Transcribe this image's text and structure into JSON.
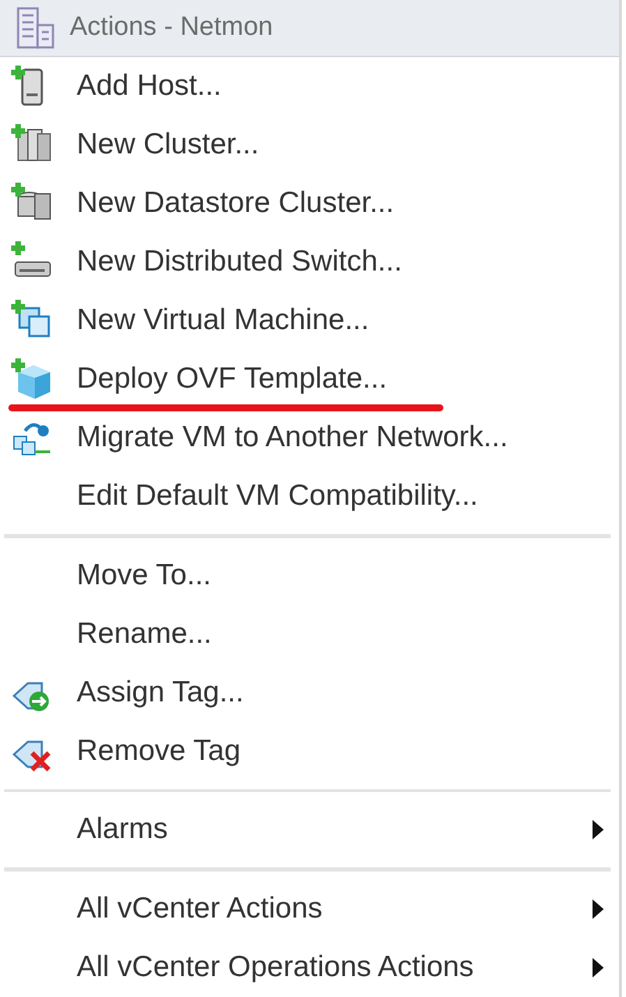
{
  "header": {
    "title": "Actions - Netmon"
  },
  "groups": [
    {
      "items": [
        {
          "label": "Add Host...",
          "kind": "host",
          "submenu": false,
          "underlined": false
        },
        {
          "label": "New Cluster...",
          "kind": "cluster",
          "submenu": false,
          "underlined": false
        },
        {
          "label": "New Datastore Cluster...",
          "kind": "datastore",
          "submenu": false,
          "underlined": false
        },
        {
          "label": "New Distributed Switch...",
          "kind": "switch",
          "submenu": false,
          "underlined": false
        },
        {
          "label": "New Virtual Machine...",
          "kind": "vm",
          "submenu": false,
          "underlined": false
        },
        {
          "label": "Deploy OVF Template...",
          "kind": "ovf",
          "submenu": false,
          "underlined": true
        },
        {
          "label": "Migrate VM to Another Network...",
          "kind": "migrate",
          "submenu": false,
          "underlined": false
        },
        {
          "label": "Edit Default VM Compatibility...",
          "kind": "plain",
          "submenu": false,
          "underlined": false
        }
      ]
    },
    {
      "items": [
        {
          "label": "Move To...",
          "kind": "plain",
          "submenu": false,
          "underlined": false
        },
        {
          "label": "Rename...",
          "kind": "plain",
          "submenu": false,
          "underlined": false
        },
        {
          "label": "Assign Tag...",
          "kind": "assign",
          "submenu": false,
          "underlined": false
        },
        {
          "label": "Remove Tag",
          "kind": "remove",
          "submenu": false,
          "underlined": false
        }
      ]
    },
    {
      "items": [
        {
          "label": "Alarms",
          "kind": "plain",
          "submenu": true,
          "underlined": false
        }
      ]
    },
    {
      "items": [
        {
          "label": "All vCenter Actions",
          "kind": "plain",
          "submenu": true,
          "underlined": false
        },
        {
          "label": "All vCenter Operations Actions",
          "kind": "plain",
          "submenu": true,
          "underlined": false
        }
      ]
    }
  ]
}
